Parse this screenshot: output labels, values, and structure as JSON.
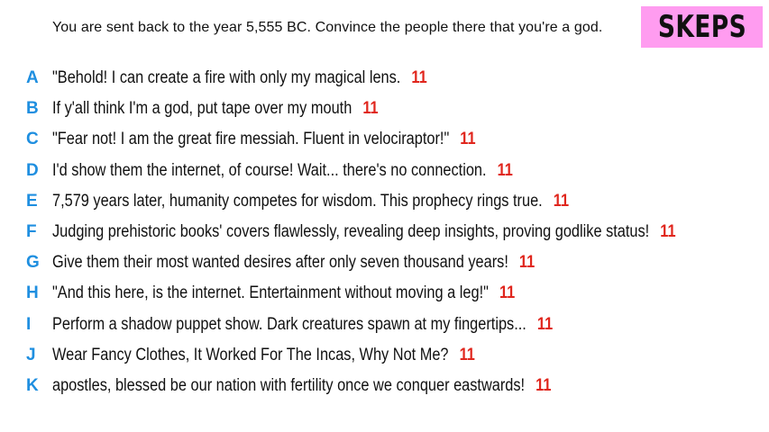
{
  "prompt": "You are sent back to the year 5,555 BC. Convince the people there that you're a god.",
  "logo": "SKEPS",
  "colors": {
    "letter": "#1f8fe0",
    "score": "#e0261d",
    "logo_bg": "#ff9cf0"
  },
  "answers": [
    {
      "letter": "A",
      "text": "\"Behold! I can create a fire with only my magical lens.",
      "score": "11"
    },
    {
      "letter": "B",
      "text": "If y'all think I'm a god, put tape over my mouth",
      "score": "11"
    },
    {
      "letter": "C",
      "text": "\"Fear not! I am the great fire messiah. Fluent in velociraptor!\"",
      "score": "11"
    },
    {
      "letter": "D",
      "text": "I'd show them the internet, of course! Wait... there's no connection.",
      "score": "11"
    },
    {
      "letter": "E",
      "text": "7,579 years later, humanity competes for wisdom. This prophecy rings true.",
      "score": "11"
    },
    {
      "letter": "F",
      "text": "Judging prehistoric books' covers flawlessly, revealing deep insights, proving godlike status!",
      "score": "11"
    },
    {
      "letter": "G",
      "text": "Give them their most wanted desires after only seven thousand years!",
      "score": "11"
    },
    {
      "letter": "H",
      "text": "\"And this here, is the internet. Entertainment without moving a leg!\"",
      "score": "11"
    },
    {
      "letter": "I",
      "text": "Perform a shadow puppet show. Dark creatures spawn at my fingertips...",
      "score": "11"
    },
    {
      "letter": "J",
      "text": "Wear Fancy Clothes, It Worked For The Incas, Why Not Me?",
      "score": "11"
    },
    {
      "letter": "K",
      "text": "apostles, blessed be our nation with fertility once we conquer eastwards!",
      "score": "11"
    }
  ]
}
